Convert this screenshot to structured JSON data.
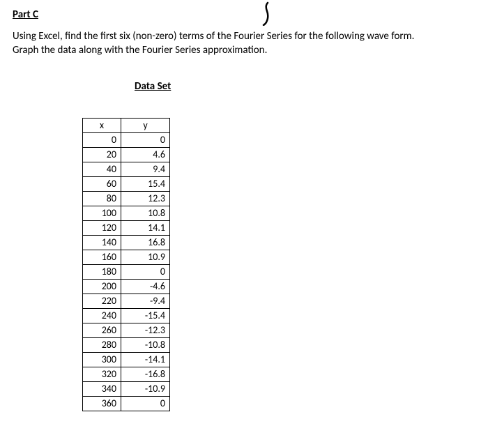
{
  "heading": "Part C",
  "instructions_line1": "Using Excel, find the first six (non-zero) terms of the Fourier Series for the following wave form.",
  "instructions_line2": "Graph the data along with the Fourier Series approximation.",
  "data_caption": "Data Set",
  "headers": {
    "x": "x",
    "y": "y"
  },
  "rows": [
    {
      "x": "0",
      "y": "0"
    },
    {
      "x": "20",
      "y": "4.6"
    },
    {
      "x": "40",
      "y": "9.4"
    },
    {
      "x": "60",
      "y": "15.4"
    },
    {
      "x": "80",
      "y": "12.3"
    },
    {
      "x": "100",
      "y": "10.8"
    },
    {
      "x": "120",
      "y": "14.1"
    },
    {
      "x": "140",
      "y": "16.8"
    },
    {
      "x": "160",
      "y": "10.9"
    },
    {
      "x": "180",
      "y": "0"
    },
    {
      "x": "200",
      "y": "-4.6"
    },
    {
      "x": "220",
      "y": "-9.4"
    },
    {
      "x": "240",
      "y": "-15.4"
    },
    {
      "x": "260",
      "y": "-12.3"
    },
    {
      "x": "280",
      "y": "-10.8"
    },
    {
      "x": "300",
      "y": "-14.1"
    },
    {
      "x": "320",
      "y": "-16.8"
    },
    {
      "x": "340",
      "y": "-10.9"
    },
    {
      "x": "360",
      "y": "0"
    }
  ]
}
